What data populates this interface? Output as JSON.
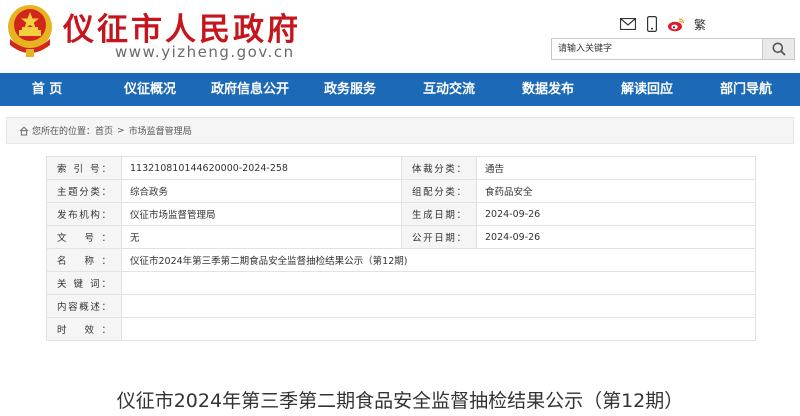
{
  "header": {
    "title": "仪征市人民政府",
    "url": "www.yizheng.gov.cn",
    "traditional_label": "繁",
    "search_placeholder": "请输入关键字",
    "icons": [
      "email-icon",
      "mobile-icon",
      "weibo-icon"
    ]
  },
  "nav": {
    "items": [
      {
        "label": "首    页"
      },
      {
        "label": "仪征概况"
      },
      {
        "label": "政府信息公开"
      },
      {
        "label": "政务服务"
      },
      {
        "label": "互动交流"
      },
      {
        "label": "数据发布"
      },
      {
        "label": "解读回应"
      },
      {
        "label": "部门导航"
      }
    ]
  },
  "breadcrumb": {
    "prefix": "您所在的位置：",
    "items": [
      "首页",
      "市场监督管理局"
    ],
    "separator": ">"
  },
  "info": {
    "index_label": "索 引 号：",
    "index_value": "113210810144620000-2024-258",
    "genre_label": "体裁分类：",
    "genre_value": "通告",
    "topic_label": "主题分类：",
    "topic_value": "综合政务",
    "group_label": "组配分类：",
    "group_value": "食药品安全",
    "org_label": "发布机构：",
    "org_value": "仪征市场监督管理局",
    "created_label": "生成日期：",
    "created_value": "2024-09-26",
    "docno_label": "文    号：",
    "docno_value": "无",
    "published_label": "公开日期：",
    "published_value": "2024-09-26",
    "name_label": "名    称：",
    "name_value": "仪征市2024年第三季第二期食品安全监督抽检结果公示（第12期)",
    "keywords_label": "关 键 词：",
    "keywords_value": "",
    "summary_label": "内容概述：",
    "summary_value": "",
    "validity_label": "时    效：",
    "validity_value": ""
  },
  "article": {
    "title": "仪征市2024年第三季第二期食品安全监督抽检结果公示（第12期）"
  },
  "colors": {
    "brand_red": "#c4161c",
    "nav_blue": "#1c69b8"
  }
}
